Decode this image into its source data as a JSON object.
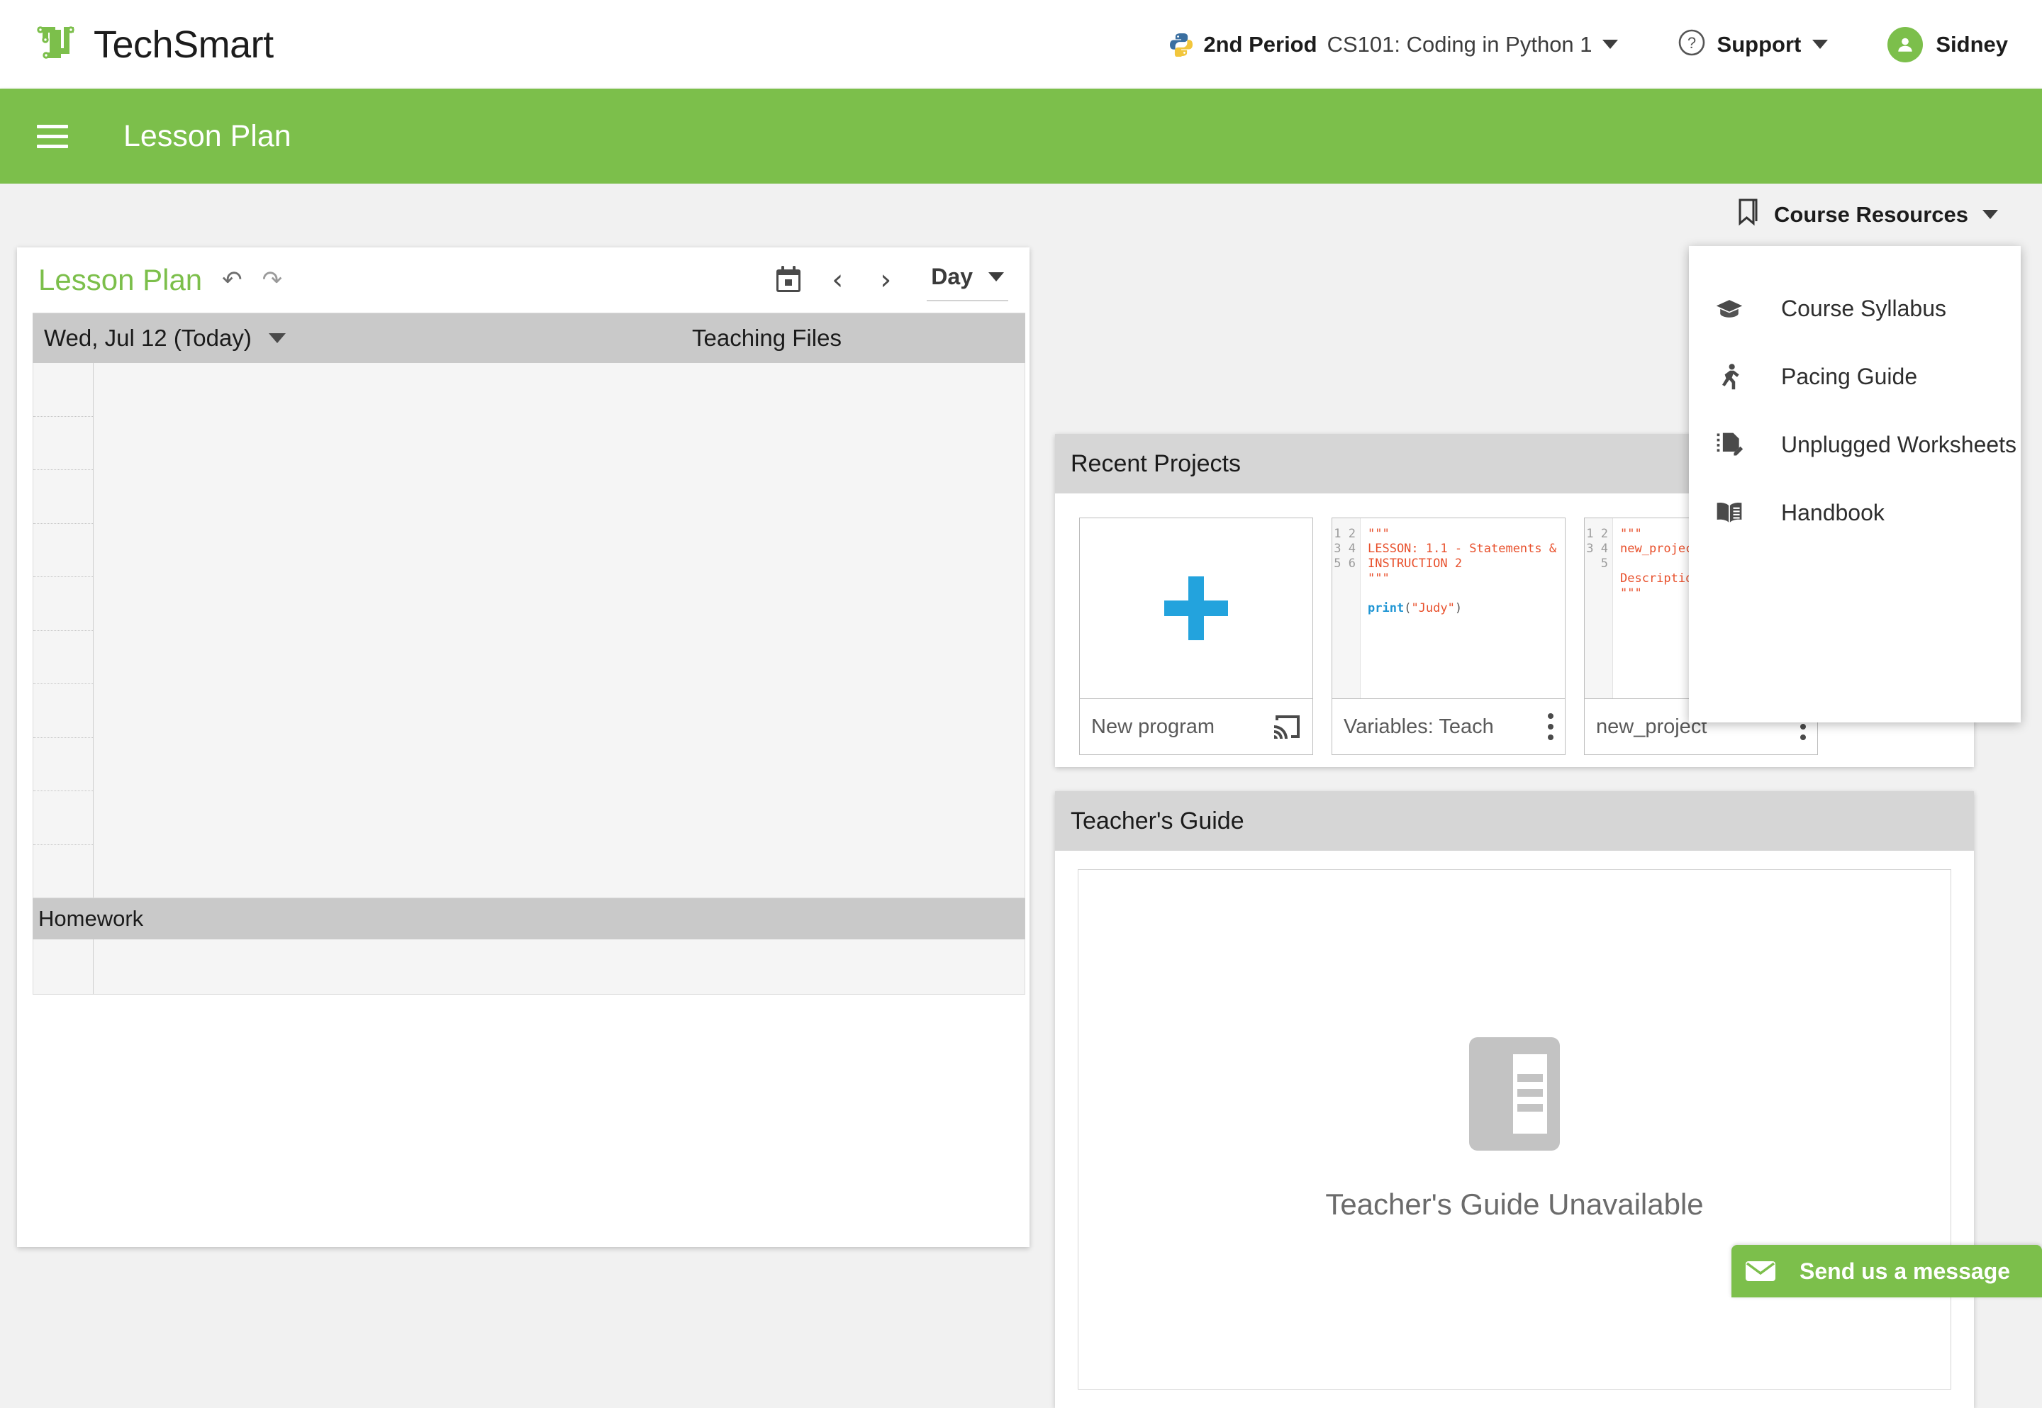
{
  "brand": {
    "name": "TechSmart",
    "logo_icon": "techsmart-logo-icon",
    "accent_color": "#7CBF4B"
  },
  "topbar": {
    "python_icon": "python-icon",
    "period": "2nd Period",
    "course": "CS101: Coding in Python 1",
    "course_caret_icon": "chevron-down-icon",
    "support_label": "Support",
    "support_icon": "help-circle-icon",
    "support_caret_icon": "chevron-down-icon",
    "user_name": "Sidney",
    "user_avatar_icon": "person-icon"
  },
  "appbar": {
    "menu_icon": "hamburger-menu-icon",
    "title": "Lesson Plan"
  },
  "course_resources": {
    "trigger_label": "Course Resources",
    "trigger_icon": "bookmark-icon",
    "trigger_caret_icon": "chevron-down-icon",
    "open": true,
    "items": [
      {
        "label": "Course Syllabus",
        "icon": "graduation-cap-icon"
      },
      {
        "label": "Pacing Guide",
        "icon": "running-person-icon"
      },
      {
        "label": "Unplugged Worksheets",
        "icon": "document-edit-icon"
      },
      {
        "label": "Handbook",
        "icon": "open-book-icon"
      }
    ]
  },
  "lesson_plan": {
    "title": "Lesson Plan",
    "undo_icon": "undo-icon",
    "redo_icon": "redo-icon",
    "calendar_icon": "calendar-icon",
    "prev_icon": "chevron-left-icon",
    "next_icon": "chevron-right-icon",
    "view_mode": "Day",
    "view_caret_icon": "chevron-down-icon",
    "date_label": "Wed, Jul 12 (Today)",
    "date_caret_icon": "chevron-down-icon",
    "column_header": "Teaching Files",
    "homework_label": "Homework",
    "row_count": 10,
    "footer_row_count": 1
  },
  "recent_projects": {
    "title": "Recent Projects",
    "cards": [
      {
        "name": "New program",
        "thumb_type": "new",
        "plus_icon": "plus-icon",
        "action_icon": "cast-icon",
        "action_name": "cast-button"
      },
      {
        "name": "Variables: Teach",
        "thumb_type": "code",
        "code_lines": [
          "\"\"\"",
          "LESSON: 1.1 - Statements &",
          "INSTRUCTION 2",
          "\"\"\"",
          "",
          "print(\"Judy\")"
        ],
        "line_numbers": [
          "1",
          "2",
          "3",
          "4",
          "5",
          "6"
        ],
        "action_icon": "more-vertical-icon",
        "action_name": "project-menu-button"
      },
      {
        "name": "new_project",
        "thumb_type": "code",
        "code_lines": [
          "\"\"\"",
          "new_project",
          "",
          "Description:",
          "\"\"\""
        ],
        "line_numbers": [
          "1",
          "2",
          "3",
          "4",
          "5"
        ],
        "action_icon": "more-vertical-icon",
        "action_name": "project-menu-button"
      }
    ]
  },
  "teachers_guide": {
    "title": "Teacher's Guide",
    "empty_icon": "document-placeholder-icon",
    "empty_message": "Teacher's Guide Unavailable"
  },
  "chat_widget": {
    "icon": "envelope-icon",
    "label": "Send us a message"
  }
}
